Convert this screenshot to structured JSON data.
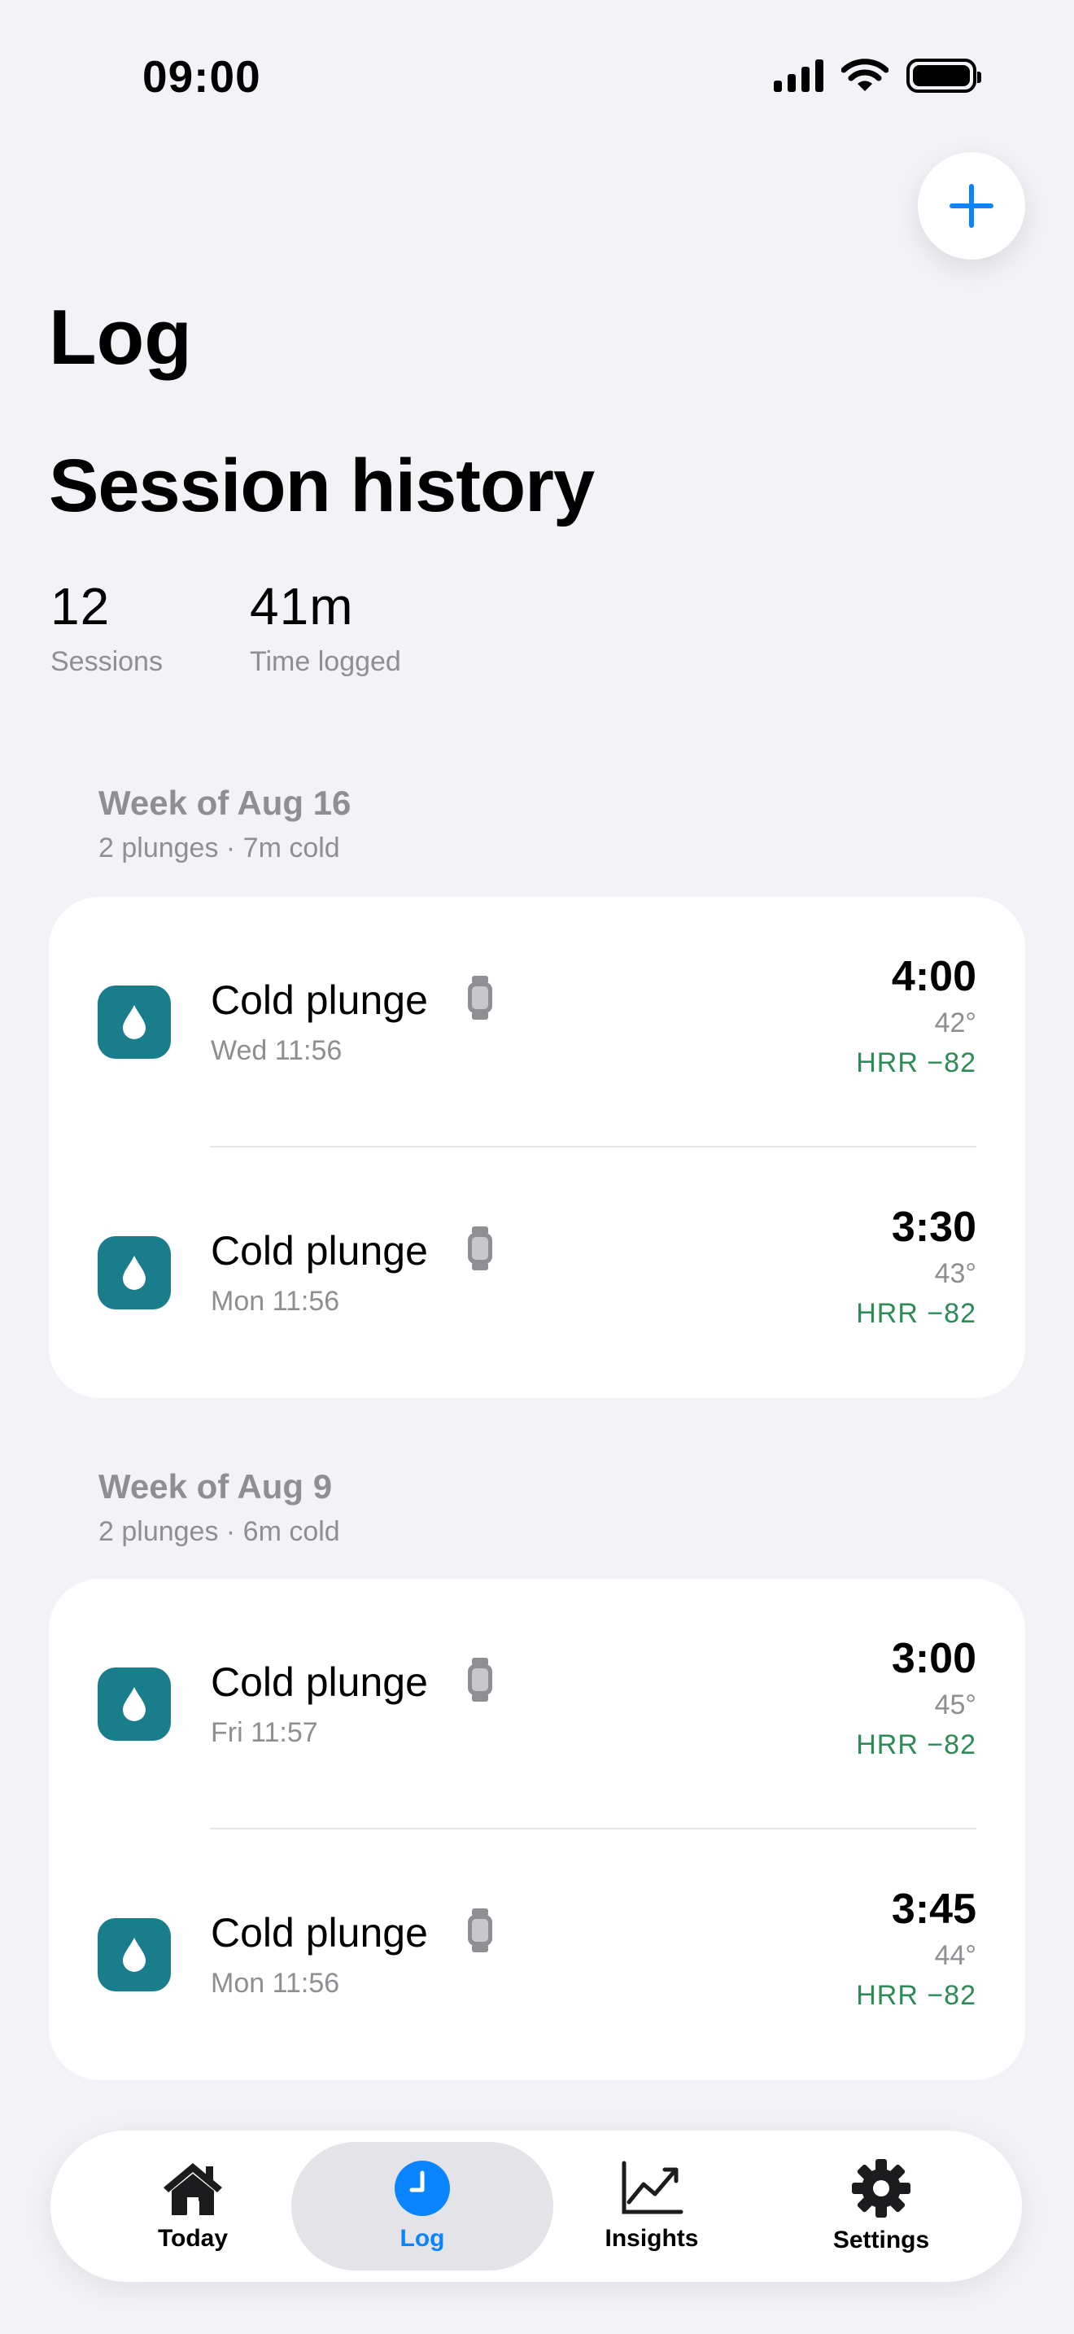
{
  "status_bar": {
    "time": "09:00"
  },
  "header": {
    "nav_title": "Log",
    "section_title": "Session history"
  },
  "stats": [
    {
      "value": "12",
      "label": "Sessions"
    },
    {
      "value": "41m",
      "label": "Time logged"
    }
  ],
  "weeks": [
    {
      "title": "Week of Aug 16",
      "summary": "2 plunges · 7m cold",
      "sessions": [
        {
          "title": "Cold plunge",
          "date": "Wed 11:56",
          "duration": "4:00",
          "temp": "42°",
          "hrr": "HRR −82"
        },
        {
          "title": "Cold plunge",
          "date": "Mon 11:56",
          "duration": "3:30",
          "temp": "43°",
          "hrr": "HRR −82"
        }
      ]
    },
    {
      "title": "Week of Aug 9",
      "summary": "2 plunges · 6m cold",
      "sessions": [
        {
          "title": "Cold plunge",
          "date": "Fri 11:57",
          "duration": "3:00",
          "temp": "45°",
          "hrr": "HRR −82"
        },
        {
          "title": "Cold plunge",
          "date": "Mon 11:56",
          "duration": "3:45",
          "temp": "44°",
          "hrr": "HRR −82"
        }
      ]
    }
  ],
  "tab_bar": {
    "tabs": [
      {
        "label": "Today",
        "icon": "house-icon"
      },
      {
        "label": "Log",
        "icon": "clock-icon",
        "active": true
      },
      {
        "label": "Insights",
        "icon": "chart-icon"
      },
      {
        "label": "Settings",
        "icon": "gear-icon"
      }
    ]
  },
  "colors": {
    "accent": "#0A84FF",
    "tile": "#1A7D8C",
    "positive": "#2E8B57",
    "secondary_text": "#8E8E93"
  }
}
